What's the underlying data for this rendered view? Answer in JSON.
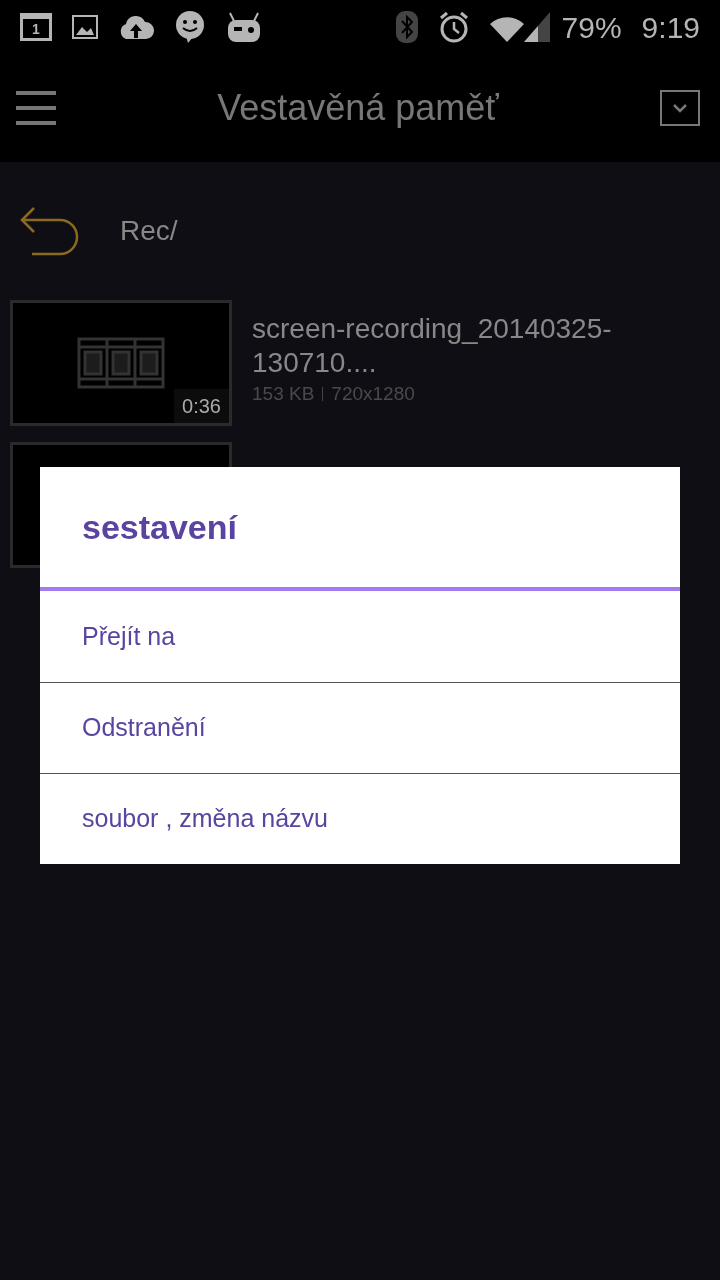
{
  "status_bar": {
    "battery": "79%",
    "time": "9:19",
    "calendar_day": "1"
  },
  "toolbar": {
    "title": "Vestavěná paměť"
  },
  "path": {
    "label": "Rec/"
  },
  "files": [
    {
      "kind": "video",
      "name": "screen-recording_20140325-130710....",
      "size": "153 KB",
      "resolution": "720x1280",
      "duration": "0:36"
    },
    {
      "kind": "covered"
    }
  ],
  "dialog": {
    "title": "sestavení",
    "items": [
      "Přejít na",
      "Odstranění",
      "soubor , změna názvu"
    ]
  }
}
